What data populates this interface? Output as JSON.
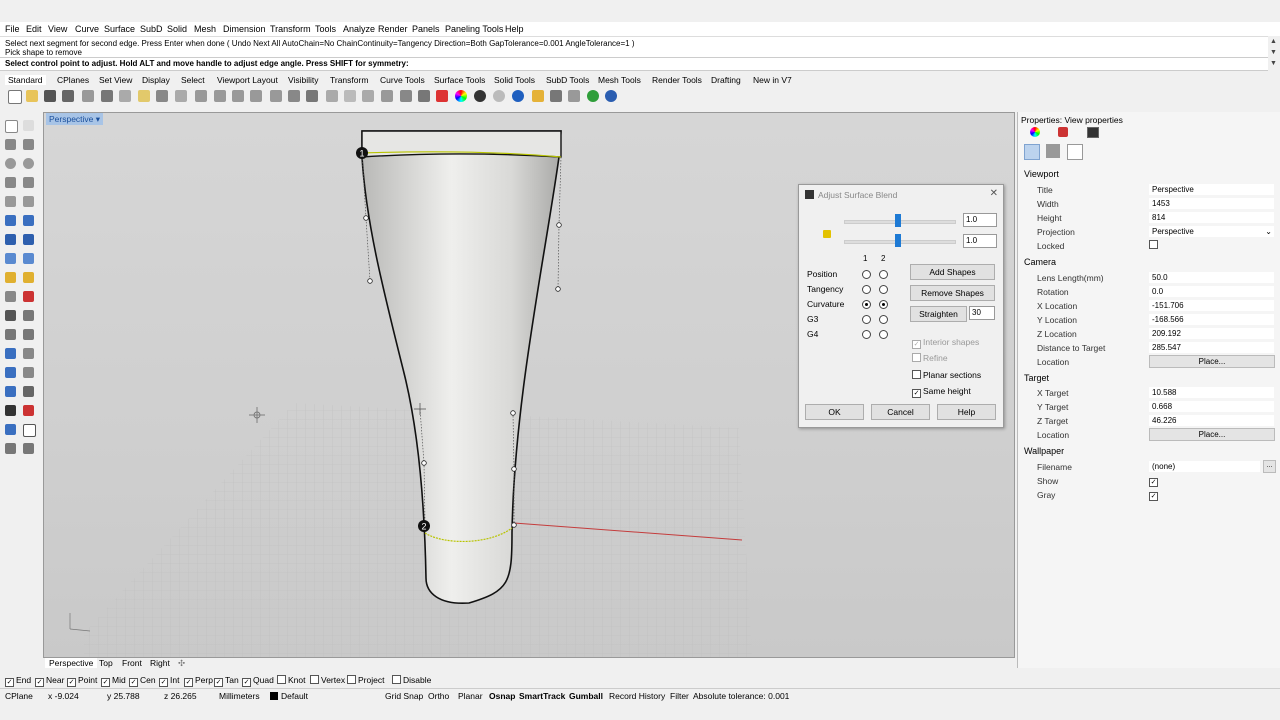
{
  "menu": [
    "File",
    "Edit",
    "View",
    "Curve",
    "Surface",
    "SubD",
    "Solid",
    "Mesh",
    "Dimension",
    "Transform",
    "Tools",
    "Analyze",
    "Render",
    "Panels",
    "Paneling Tools",
    "Help"
  ],
  "command": {
    "history_1": "Select next segment for second edge. Press Enter when done ( Undo  Next  All  AutoChain=No  ChainContinuity=Tangency  Direction=Both  GapTolerance=0.001  AngleTolerance=1 )",
    "history_2": "Pick shape to remove",
    "prompt": "Select control point to adjust. Hold ALT and move handle to adjust edge angle. Press SHIFT for symmetry:"
  },
  "toolbar_tabs": [
    "Standard",
    "CPlanes",
    "Set View",
    "Display",
    "Select",
    "Viewport Layout",
    "Visibility",
    "Transform",
    "Curve Tools",
    "Surface Tools",
    "Solid Tools",
    "SubD Tools",
    "Mesh Tools",
    "Render Tools",
    "Drafting",
    "New in V7"
  ],
  "viewport": {
    "label": "Perspective",
    "marker_1": "1",
    "marker_2": "2"
  },
  "viewport_tabs": [
    "Perspective",
    "Top",
    "Front",
    "Right"
  ],
  "dialog": {
    "title": "Adjust Surface Blend",
    "slider1_value": "1.0",
    "slider2_value": "1.0",
    "col1": "1",
    "col2": "2",
    "rows": [
      "Position",
      "Tangency",
      "Curvature",
      "G3",
      "G4"
    ],
    "selected_row": "Curvature",
    "add_shapes": "Add Shapes",
    "remove_shapes": "Remove Shapes",
    "straighten": "Straighten",
    "straighten_value": "30",
    "interior_shapes": "Interior shapes",
    "refine": "Refine",
    "planar_sections": "Planar sections",
    "same_height": "Same height",
    "ok": "OK",
    "cancel": "Cancel",
    "help": "Help"
  },
  "properties": {
    "header": "Properties: View properties",
    "viewport_section": "Viewport",
    "title_label": "Title",
    "title_value": "Perspective",
    "width_label": "Width",
    "width_value": "1453",
    "height_label": "Height",
    "height_value": "814",
    "projection_label": "Projection",
    "projection_value": "Perspective",
    "locked_label": "Locked",
    "camera_section": "Camera",
    "lens_label": "Lens Length(mm)",
    "lens_value": "50.0",
    "rotation_label": "Rotation",
    "rotation_value": "0.0",
    "xloc_label": "X Location",
    "xloc_value": "-151.706",
    "yloc_label": "Y Location",
    "yloc_value": "-168.566",
    "zloc_label": "Z Location",
    "zloc_value": "209.192",
    "dist_label": "Distance to Target",
    "dist_value": "285.547",
    "location_label": "Location",
    "place": "Place...",
    "target_section": "Target",
    "xt_label": "X Target",
    "xt_value": "10.588",
    "yt_label": "Y Target",
    "yt_value": "0.668",
    "zt_label": "Z Target",
    "zt_value": "46.226",
    "tloc_label": "Location",
    "wallpaper_section": "Wallpaper",
    "filename_label": "Filename",
    "filename_value": "(none)",
    "show_label": "Show",
    "gray_label": "Gray",
    "dots": "..."
  },
  "osnap": [
    {
      "label": "End",
      "checked": true
    },
    {
      "label": "Near",
      "checked": true
    },
    {
      "label": "Point",
      "checked": true
    },
    {
      "label": "Mid",
      "checked": true
    },
    {
      "label": "Cen",
      "checked": true
    },
    {
      "label": "Int",
      "checked": true
    },
    {
      "label": "Perp",
      "checked": true
    },
    {
      "label": "Tan",
      "checked": true
    },
    {
      "label": "Quad",
      "checked": true
    },
    {
      "label": "Knot",
      "checked": false
    },
    {
      "label": "Vertex",
      "checked": false
    },
    {
      "label": "Project",
      "checked": false
    },
    {
      "label": "Disable",
      "checked": false
    }
  ],
  "status": {
    "cplane": "CPlane",
    "x": "x -9.024",
    "y": "y 25.788",
    "z": "z 26.265",
    "units": "Millimeters",
    "layer": "Default",
    "grid_snap": "Grid Snap",
    "ortho": "Ortho",
    "planar": "Planar",
    "osnap": "Osnap",
    "smarttrack": "SmartTrack",
    "gumball": "Gumball",
    "record_history": "Record History",
    "filter": "Filter",
    "tolerance": "Absolute tolerance: 0.001"
  }
}
